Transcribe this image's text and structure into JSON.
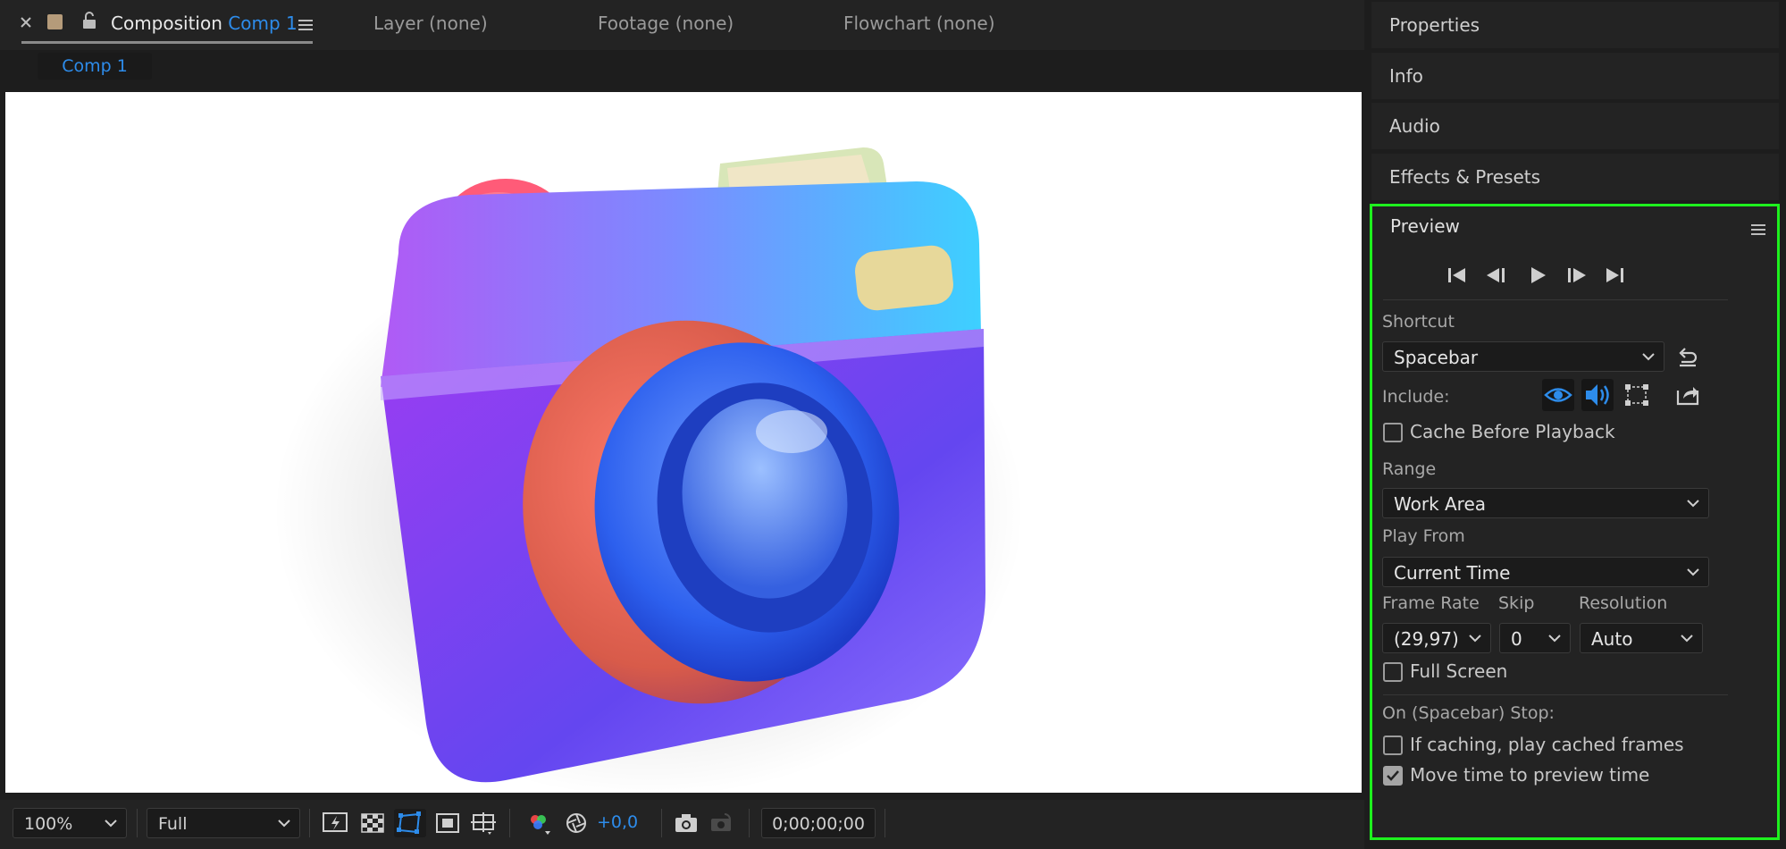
{
  "composition_panel": {
    "tab": {
      "prefix": "Composition",
      "comp_name": "Comp 1"
    },
    "other_tabs": [
      "Layer (none)",
      "Footage (none)",
      "Flowchart (none)"
    ],
    "breadcrumb": "Comp 1"
  },
  "viewer_toolbar": {
    "zoom": "100%",
    "resolution": "Full",
    "exposure": "+0,0",
    "timecode": "0;00;00;00"
  },
  "right_panels": [
    "Properties",
    "Info",
    "Audio",
    "Effects & Presets"
  ],
  "preview": {
    "title": "Preview",
    "shortcut_label": "Shortcut",
    "shortcut_value": "Spacebar",
    "include_label": "Include:",
    "cache_before_playback": {
      "label": "Cache Before Playback",
      "checked": false
    },
    "range_label": "Range",
    "range_value": "Work Area",
    "play_from_label": "Play From",
    "play_from_value": "Current Time",
    "frame_rate_label": "Frame Rate",
    "frame_rate_value": "(29,97)",
    "skip_label": "Skip",
    "skip_value": "0",
    "resolution_label": "Resolution",
    "resolution_value": "Auto",
    "full_screen": {
      "label": "Full Screen",
      "checked": false
    },
    "stop_label": "On (Spacebar) Stop:",
    "if_caching": {
      "label": "If caching, play cached frames",
      "checked": false
    },
    "move_time": {
      "label": "Move time to preview time",
      "checked": true
    }
  },
  "colors": {
    "accent_blue": "#2d8ceb",
    "highlight_border": "#1ef01e",
    "panel_bg": "#232323",
    "app_bg": "#1d1d1d"
  }
}
